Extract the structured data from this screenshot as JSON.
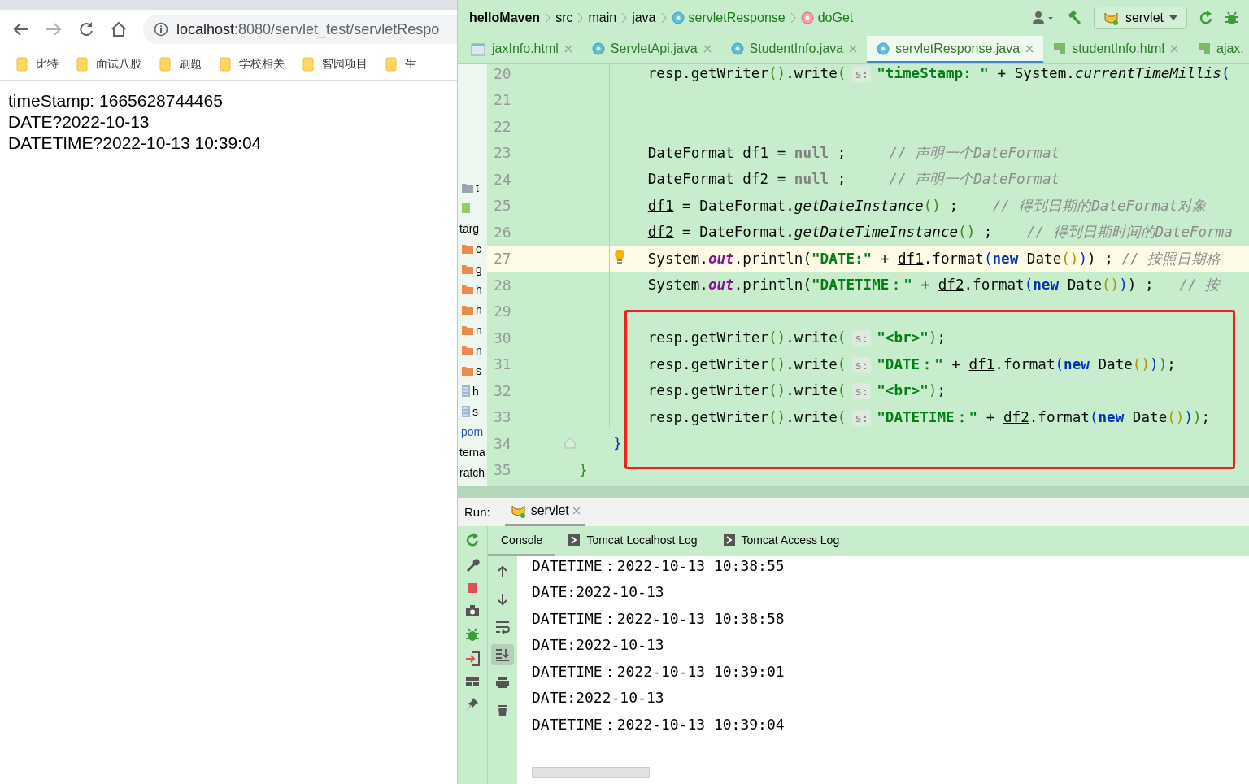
{
  "browser": {
    "address": {
      "host": "localhost",
      "path": ":8080/servlet_test/servletRespo"
    },
    "bookmarks": [
      {
        "label": "比特"
      },
      {
        "label": "面试八股"
      },
      {
        "label": "刷题"
      },
      {
        "label": "学校相关"
      },
      {
        "label": "智园项目"
      },
      {
        "label": "生"
      }
    ],
    "page_lines": [
      "timeStamp: 1665628744465",
      "DATE?2022-10-13",
      "DATETIME?2022-10-13 10:39:04"
    ]
  },
  "ide": {
    "breadcrumbs": [
      {
        "label": "helloMaven",
        "kind": "project"
      },
      {
        "label": "src",
        "kind": "folder"
      },
      {
        "label": "main",
        "kind": "folder"
      },
      {
        "label": "java",
        "kind": "folder"
      },
      {
        "label": "servletResponse",
        "kind": "class"
      },
      {
        "label": "doGet",
        "kind": "method"
      }
    ],
    "run_config": "servlet",
    "tabs": [
      {
        "label": "jaxInfo.html",
        "kind": "html-cut",
        "selected": false
      },
      {
        "label": "ServletApi.java",
        "kind": "class",
        "selected": false
      },
      {
        "label": "StudentInfo.java",
        "kind": "class",
        "selected": false
      },
      {
        "label": "servletResponse.java",
        "kind": "class",
        "selected": true
      },
      {
        "label": "studentInfo.html",
        "kind": "html",
        "selected": false
      },
      {
        "label": "ajax.",
        "kind": "html-end",
        "selected": false
      }
    ],
    "project_tree": [
      {
        "label": "t",
        "kind": "folder-grey"
      },
      {
        "kind": "resource"
      },
      {
        "label": "targ",
        "kind": "text"
      },
      {
        "label": "c",
        "kind": "folder"
      },
      {
        "label": "g",
        "kind": "folder"
      },
      {
        "label": "h",
        "kind": "folder"
      },
      {
        "label": "h",
        "kind": "folder"
      },
      {
        "label": "n",
        "kind": "folder"
      },
      {
        "label": "n",
        "kind": "folder"
      },
      {
        "label": "s",
        "kind": "folder"
      },
      {
        "label": "h",
        "kind": "file"
      },
      {
        "label": "s",
        "kind": "file"
      },
      {
        "label": "pom",
        "kind": "maven"
      },
      {
        "label": "terna",
        "kind": "text"
      },
      {
        "label": "ratch",
        "kind": "text"
      }
    ],
    "code_lines": [
      {
        "number": "20",
        "kind": "statement",
        "current": false,
        "marked": false,
        "bulb": false,
        "fold": false,
        "segments": [
          {
            "kind": "plain",
            "text": "resp.getWriter"
          },
          {
            "kind": "paren-a",
            "text": "()"
          },
          {
            "kind": "plain",
            "text": ".write"
          },
          {
            "kind": "paren-a",
            "text": "("
          },
          {
            "kind": "hint",
            "text": "s:"
          },
          {
            "kind": "string",
            "text": "\"timeStamp: \""
          },
          {
            "kind": "plain",
            "text": " + System."
          },
          {
            "kind": "method",
            "text": "currentTimeMillis"
          },
          {
            "kind": "paren-b",
            "text": "("
          }
        ]
      },
      {
        "number": "21",
        "current": false,
        "marked": false,
        "bulb": false,
        "fold": false
      },
      {
        "number": "22",
        "current": false,
        "marked": false,
        "bulb": false,
        "fold": false
      },
      {
        "number": "23",
        "kind": "statement",
        "current": false,
        "marked": false,
        "bulb": false,
        "fold": false,
        "segments": [
          {
            "kind": "plain",
            "text": "DateFormat "
          },
          {
            "kind": "var",
            "text": "df1"
          },
          {
            "kind": "plain",
            "text": " = "
          },
          {
            "kind": "null",
            "text": "null"
          },
          {
            "kind": "plain",
            "text": " ;     "
          },
          {
            "kind": "comment",
            "text": "// 声明一个DateFormat"
          }
        ]
      },
      {
        "number": "24",
        "kind": "statement",
        "current": false,
        "marked": false,
        "bulb": false,
        "fold": false,
        "segments": [
          {
            "kind": "plain",
            "text": "DateFormat "
          },
          {
            "kind": "var",
            "text": "df2"
          },
          {
            "kind": "plain",
            "text": " = "
          },
          {
            "kind": "null",
            "text": "null"
          },
          {
            "kind": "plain",
            "text": " ;     "
          },
          {
            "kind": "comment",
            "text": "// 声明一个DateFormat"
          }
        ]
      },
      {
        "number": "25",
        "kind": "statement",
        "current": false,
        "marked": false,
        "bulb": false,
        "fold": false,
        "segments": [
          {
            "kind": "var",
            "text": "df1"
          },
          {
            "kind": "plain",
            "text": " = DateFormat."
          },
          {
            "kind": "method",
            "text": "getDateInstance"
          },
          {
            "kind": "paren-a",
            "text": "()"
          },
          {
            "kind": "plain",
            "text": " ;    "
          },
          {
            "kind": "comment",
            "text": "// 得到日期的DateFormat对象"
          }
        ]
      },
      {
        "number": "26",
        "kind": "statement",
        "current": false,
        "marked": false,
        "bulb": false,
        "fold": false,
        "segments": [
          {
            "kind": "var",
            "text": "df2"
          },
          {
            "kind": "plain",
            "text": " = DateFormat."
          },
          {
            "kind": "method",
            "text": "getDateTimeInstance"
          },
          {
            "kind": "paren-a",
            "text": "()"
          },
          {
            "kind": "plain",
            "text": " ;    "
          },
          {
            "kind": "comment",
            "text": "// 得到日期时间的DateForma"
          }
        ]
      },
      {
        "number": "27",
        "kind": "statement",
        "current": true,
        "marked": false,
        "bulb": true,
        "fold": false,
        "segments": [
          {
            "kind": "plain",
            "text": "System."
          },
          {
            "kind": "field",
            "text": "out"
          },
          {
            "kind": "plain",
            "text": ".println("
          },
          {
            "kind": "string",
            "text": "\"DATE:\""
          },
          {
            "kind": "plain",
            "text": " + "
          },
          {
            "kind": "var",
            "text": "df1"
          },
          {
            "kind": "plain",
            "text": ".format"
          },
          {
            "kind": "paren-b",
            "text": "("
          },
          {
            "kind": "keyword",
            "text": "new"
          },
          {
            "kind": "plain",
            "text": " Date"
          },
          {
            "kind": "paren-c",
            "text": "()"
          },
          {
            "kind": "paren-b",
            "text": ")"
          },
          {
            "kind": "plain",
            "text": ") ; "
          },
          {
            "kind": "comment",
            "text": "// 按照日期格"
          }
        ]
      },
      {
        "number": "28",
        "kind": "statement",
        "current": false,
        "marked": false,
        "bulb": false,
        "fold": false,
        "segments": [
          {
            "kind": "plain",
            "text": "System."
          },
          {
            "kind": "field",
            "text": "out"
          },
          {
            "kind": "plain",
            "text": ".println("
          },
          {
            "kind": "string",
            "text": "\"DATETIME：\""
          },
          {
            "kind": "plain",
            "text": " + "
          },
          {
            "kind": "var",
            "text": "df2"
          },
          {
            "kind": "plain",
            "text": ".format"
          },
          {
            "kind": "paren-b",
            "text": "("
          },
          {
            "kind": "keyword",
            "text": "new"
          },
          {
            "kind": "plain",
            "text": " Date"
          },
          {
            "kind": "paren-c",
            "text": "()"
          },
          {
            "kind": "paren-b",
            "text": ")"
          },
          {
            "kind": "plain",
            "text": ") ;   "
          },
          {
            "kind": "comment",
            "text": "// 按"
          }
        ]
      },
      {
        "number": "29",
        "current": false,
        "marked": false,
        "bulb": false,
        "fold": false
      },
      {
        "number": "30",
        "kind": "statement",
        "current": false,
        "marked": true,
        "bulb": false,
        "fold": false,
        "segments": [
          {
            "kind": "plain",
            "text": "resp.getWriter"
          },
          {
            "kind": "paren-a",
            "text": "()"
          },
          {
            "kind": "plain",
            "text": ".write"
          },
          {
            "kind": "paren-a",
            "text": "("
          },
          {
            "kind": "hint",
            "text": "s:"
          },
          {
            "kind": "string",
            "text": "\"<br>\""
          },
          {
            "kind": "paren-a",
            "text": ")"
          },
          {
            "kind": "plain",
            "text": ";"
          }
        ]
      },
      {
        "number": "31",
        "kind": "statement",
        "current": false,
        "marked": true,
        "bulb": false,
        "fold": false,
        "segments": [
          {
            "kind": "plain",
            "text": "resp.getWriter"
          },
          {
            "kind": "paren-a",
            "text": "()"
          },
          {
            "kind": "plain",
            "text": ".write"
          },
          {
            "kind": "paren-a",
            "text": "("
          },
          {
            "kind": "hint",
            "text": "s:"
          },
          {
            "kind": "string",
            "text": "\"DATE：\""
          },
          {
            "kind": "plain",
            "text": " + "
          },
          {
            "kind": "var",
            "text": "df1"
          },
          {
            "kind": "plain",
            "text": ".format"
          },
          {
            "kind": "paren-b",
            "text": "("
          },
          {
            "kind": "keyword",
            "text": "new"
          },
          {
            "kind": "plain",
            "text": " Date"
          },
          {
            "kind": "paren-c",
            "text": "()"
          },
          {
            "kind": "paren-b",
            "text": ")"
          },
          {
            "kind": "paren-a",
            "text": ")"
          },
          {
            "kind": "plain",
            "text": ";"
          }
        ]
      },
      {
        "number": "32",
        "kind": "statement",
        "current": false,
        "marked": true,
        "bulb": false,
        "fold": false,
        "segments": [
          {
            "kind": "plain",
            "text": "resp.getWriter"
          },
          {
            "kind": "paren-a",
            "text": "()"
          },
          {
            "kind": "plain",
            "text": ".write"
          },
          {
            "kind": "paren-a",
            "text": "("
          },
          {
            "kind": "hint",
            "text": "s:"
          },
          {
            "kind": "string",
            "text": "\"<br>\""
          },
          {
            "kind": "paren-a",
            "text": ")"
          },
          {
            "kind": "plain",
            "text": ";"
          }
        ]
      },
      {
        "number": "33",
        "kind": "statement",
        "current": false,
        "marked": true,
        "bulb": false,
        "fold": false,
        "segments": [
          {
            "kind": "plain",
            "text": "resp.getWriter"
          },
          {
            "kind": "paren-a",
            "text": "()"
          },
          {
            "kind": "plain",
            "text": ".write"
          },
          {
            "kind": "paren-a",
            "text": "("
          },
          {
            "kind": "hint",
            "text": "s:"
          },
          {
            "kind": "string",
            "text": "\"DATETIME：\""
          },
          {
            "kind": "plain",
            "text": " + "
          },
          {
            "kind": "var",
            "text": "df2"
          },
          {
            "kind": "plain",
            "text": ".format"
          },
          {
            "kind": "paren-b",
            "text": "("
          },
          {
            "kind": "keyword",
            "text": "new"
          },
          {
            "kind": "plain",
            "text": " Date"
          },
          {
            "kind": "paren-c",
            "text": "()"
          },
          {
            "kind": "paren-b",
            "text": ")"
          },
          {
            "kind": "paren-a",
            "text": ")"
          },
          {
            "kind": "plain",
            "text": ";"
          }
        ]
      },
      {
        "number": "34",
        "kind": "method-end",
        "current": false,
        "marked": true,
        "bulb": false,
        "fold": true,
        "segments": [
          {
            "kind": "paren-b",
            "text": "}"
          }
        ]
      },
      {
        "number": "35",
        "kind": "class-end",
        "current": false,
        "marked": false,
        "bulb": false,
        "fold": false,
        "segments": [
          {
            "kind": "paren-a",
            "text": "}"
          }
        ]
      }
    ],
    "run": {
      "label": "Run:",
      "tab": "servlet",
      "console_tabs": [
        {
          "label": "Console",
          "kind": "plain",
          "selected": true
        },
        {
          "label": "Tomcat Localhost Log",
          "kind": "log",
          "selected": false
        },
        {
          "label": "Tomcat Access Log",
          "kind": "log",
          "selected": false
        }
      ],
      "console_tools": [
        {
          "kind": "up",
          "on": false
        },
        {
          "kind": "down",
          "on": false
        },
        {
          "kind": "wrap",
          "on": false
        },
        {
          "kind": "scroll-end",
          "on": true
        },
        {
          "kind": "print",
          "on": false
        },
        {
          "kind": "clear",
          "on": false
        }
      ],
      "output": [
        "DATETIME：2022-10-13 10:38:55",
        "DATE:2022-10-13",
        "DATETIME：2022-10-13 10:38:58",
        "DATE:2022-10-13",
        "DATETIME：2022-10-13 10:39:01",
        "DATE:2022-10-13",
        "DATETIME：2022-10-13 10:39:04"
      ]
    }
  }
}
